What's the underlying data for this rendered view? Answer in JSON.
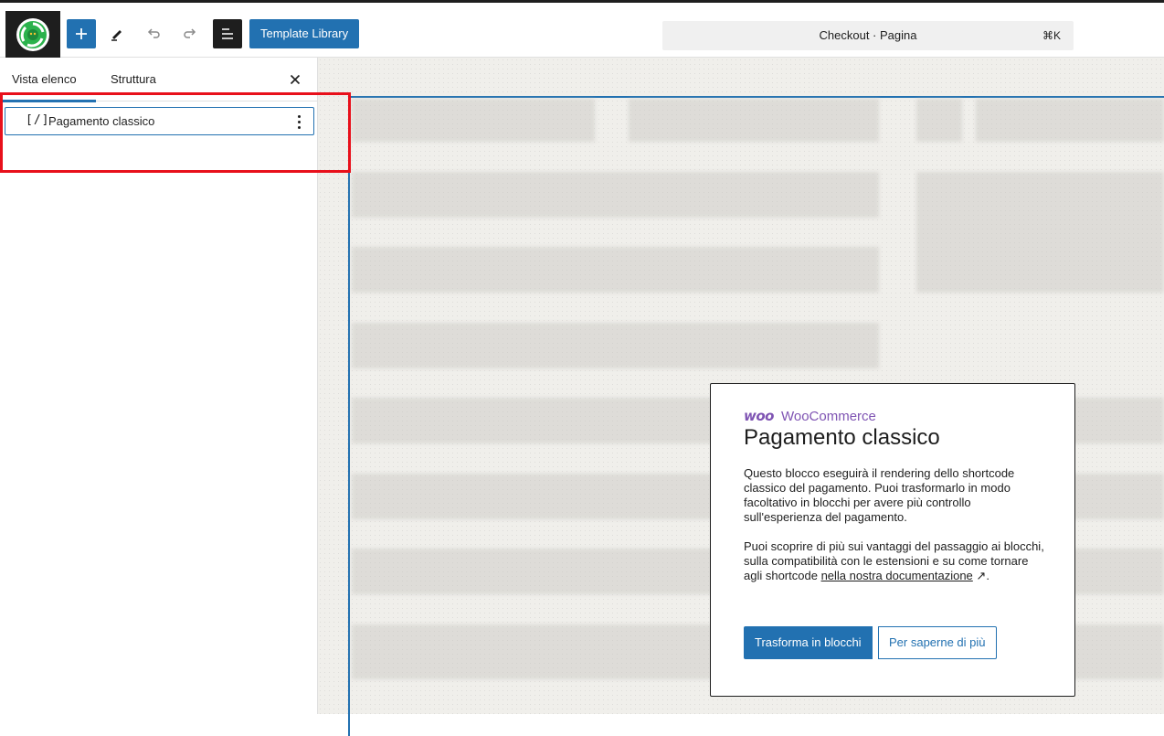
{
  "header": {
    "template_library_label": "Template Library",
    "document_title": "Checkout · Pagina",
    "shortcut": "⌘K"
  },
  "sidebar": {
    "tabs": [
      {
        "label": "Vista elenco"
      },
      {
        "label": "Struttura"
      }
    ],
    "items": [
      {
        "icon": "[/]",
        "label": "Pagamento classico"
      }
    ]
  },
  "card": {
    "brand_logo": "woo",
    "brand_name": "WooCommerce",
    "title": "Pagamento classico",
    "paragraph1": "Questo blocco eseguirà il rendering dello shortcode classico del pagamento. Puoi trasformarlo in modo facoltativo in blocchi per avere più controllo sull'esperienza del pagamento.",
    "paragraph2": "Puoi scoprire di più sui vantaggi del passaggio ai blocchi, sulla compatibilità con le estensioni e su come tornare agli shortcode ",
    "doc_link": "nella nostra documentazione",
    "doc_arrow": "↗",
    "paragraph2_end": ".",
    "primary_button": "Trasforma in blocchi",
    "secondary_button": "Per saperne di più"
  },
  "colors": {
    "accent": "#2271b1",
    "woo_purple": "#7f54b3",
    "highlight_red": "#e8101b"
  }
}
